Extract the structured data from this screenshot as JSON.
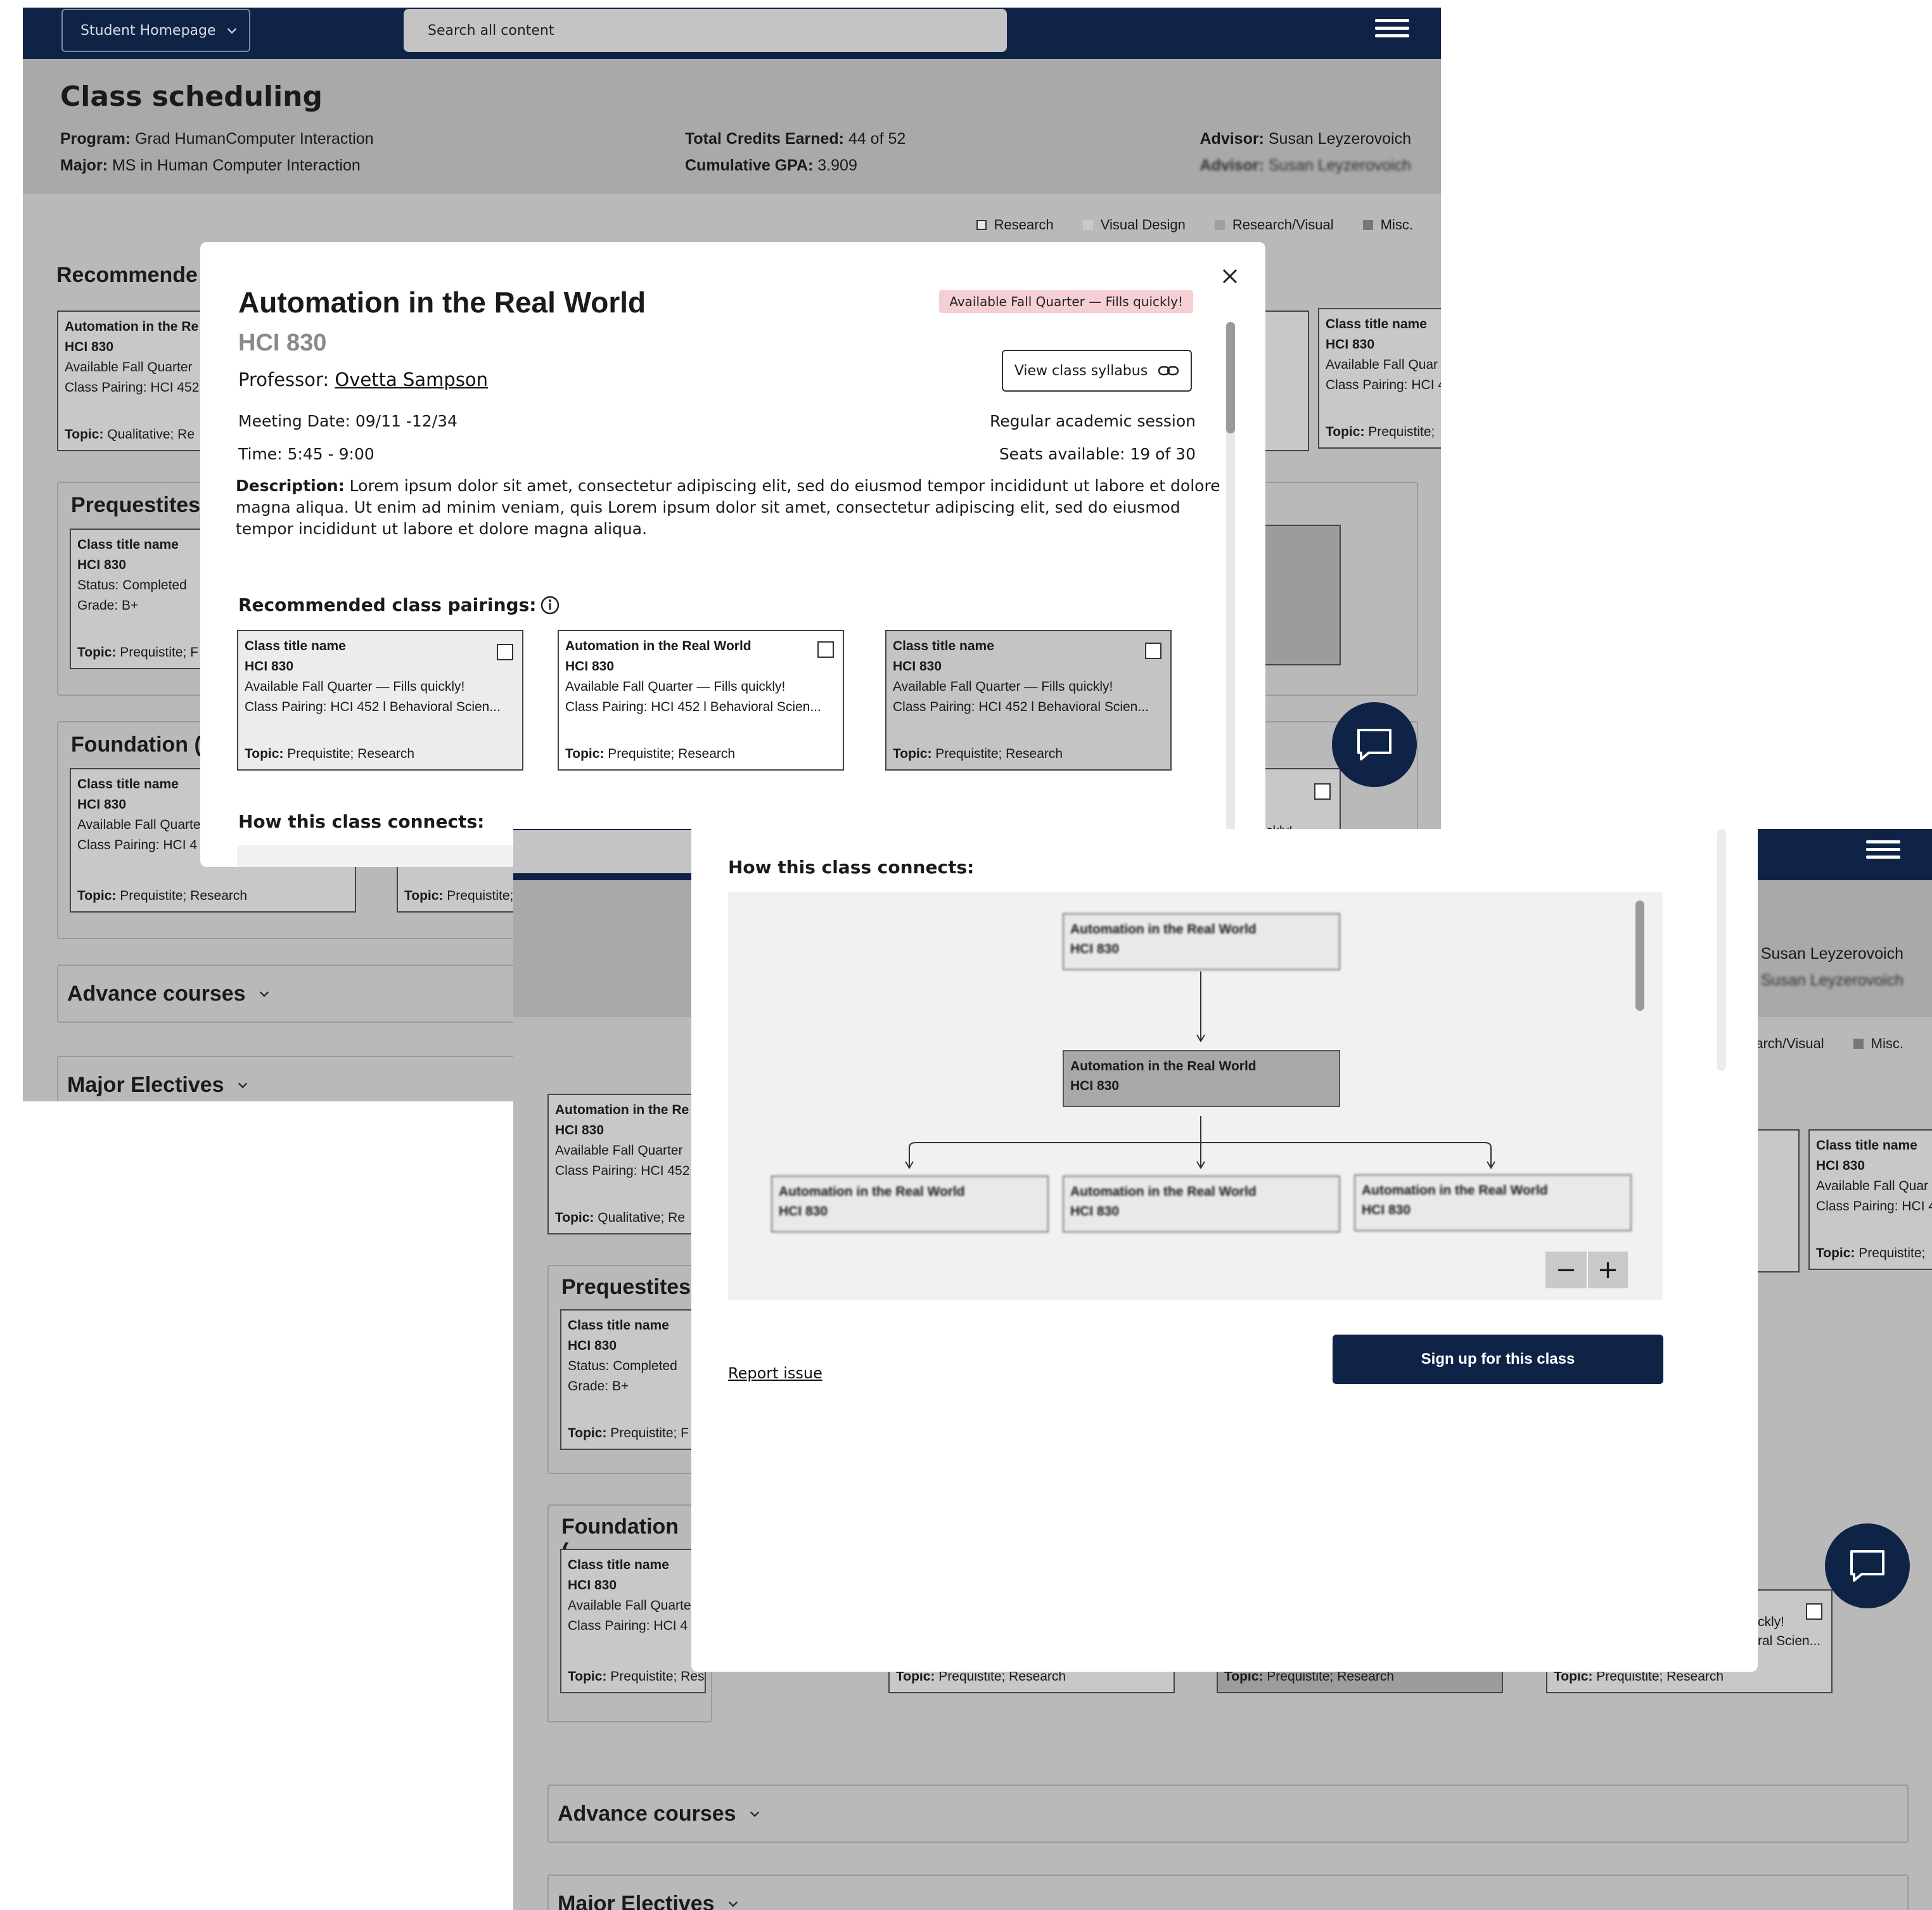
{
  "header": {
    "home_button": "Student Homepage",
    "search_placeholder": "Search all content"
  },
  "page": {
    "title": "Class scheduling",
    "program_label": "Program:",
    "program_value": "Grad HumanComputer Interaction",
    "major_label": "Major:",
    "major_value": "MS in Human Computer Interaction",
    "credits_label": "Total Credits Earned:",
    "credits_value": "44 of 52",
    "gpa_label": "Cumulative GPA:",
    "gpa_value": "3.909",
    "advisor_label": "Advisor:",
    "advisor_value": "Susan Leyzerovoich",
    "advisor_blur_label": "Advisor:",
    "advisor_blur_value": "Susan Leyzerovoich"
  },
  "legend": [
    "Research",
    "Visual Design",
    "Research/Visual",
    "Misc."
  ],
  "colors": {
    "navy": "#0f2347",
    "badge": "#f5cfd3",
    "background": "#b9b9b9"
  },
  "sections": {
    "recommended": "Recommende",
    "prereq": "Prequestites",
    "foundation": "Foundation (",
    "advance": "Advance courses",
    "electives": "Major Electives"
  },
  "bg_cards": {
    "rec_left": {
      "title": "Automation in the Re",
      "code": "HCI 830",
      "avail": "Available Fall Quarter",
      "pairing": "Class Pairing: HCI 452",
      "topic_label": "Topic:",
      "topic": "Qualitative; Re"
    },
    "rec_right": {
      "title": "Class title name",
      "code": "HCI 830",
      "avail": "Available Fall Quar",
      "pairing": "Class Pairing: HCI 4",
      "topic_label": "Topic:",
      "topic": "Prequistite;"
    },
    "prereq_left": {
      "title": "Class title name",
      "code": "HCI 830",
      "status": "Status: Completed",
      "grade": "Grade: B+",
      "topic_label": "Topic:",
      "topic": "Prequistite; F"
    },
    "found_1": {
      "title": "Class title name",
      "code": "HCI 830",
      "avail": "Available Fall Quarte",
      "pairing": "Class Pairing: HCI 4",
      "topic_label": "Topic:",
      "topic": "Prequistite; Research"
    },
    "found_topic_label": "Topic:",
    "found_topic": "Prequistite; Research",
    "found_right_avail": "ckly!",
    "found_right_pairing": "ral Scien...",
    "rec_right_ellipsis": "..."
  },
  "modal": {
    "title": "Automation in the Real World",
    "code": "HCI 830",
    "badge": "Available Fall Quarter — Fills quickly!",
    "professor_label": "Professor:",
    "professor": "Ovetta Sampson",
    "syllabus_button": "View class syllabus",
    "meeting_label": "Meeting Date:",
    "meeting_value": "09/11 -12/34",
    "time_label": "Time:",
    "time_value": "5:45 - 9:00",
    "session": "Regular academic session",
    "seats_label": "Seats available:",
    "seats_value": "19 of 30",
    "description_label": "Description:",
    "description": "Lorem ipsum dolor sit amet, consectetur adipiscing elit, sed do eiusmod tempor incididunt ut labore et dolore magna aliqua. Ut enim ad minim veniam, quis Lorem ipsum dolor sit amet, consectetur adipiscing elit, sed do eiusmod tempor incididunt ut labore et dolore magna aliqua.",
    "pairings_heading": "Recommended class pairings:",
    "pairings": [
      {
        "title": "Class title name",
        "code": "HCI 830",
        "avail": "Available Fall Quarter — Fills quickly!",
        "pairing": "Class Pairing: HCI 452 l Behavioral Scien...",
        "topic_label": "Topic:",
        "topic": "Prequistite; Research"
      },
      {
        "title": "Automation in the Real World",
        "code": "HCI 830",
        "avail": "Available Fall Quarter — Fills quickly!",
        "pairing": "Class Pairing: HCI 452 l Behavioral Scien...",
        "topic_label": "Topic:",
        "topic": "Prequistite; Research"
      },
      {
        "title": "Class title name",
        "code": "HCI 830",
        "avail": "Available Fall Quarter — Fills quickly!",
        "pairing": "Class Pairing: HCI 452 l Behavioral Scien...",
        "topic_label": "Topic:",
        "topic": "Prequistite; Research"
      }
    ],
    "connects_heading": "How this class connects:",
    "graph_nodes": {
      "top": {
        "title": "Automation in the Real World",
        "code": "HCI 830"
      },
      "center": {
        "title": "Automation in the Real World",
        "code": "HCI 830"
      },
      "left": {
        "title": "Automation in the Real World",
        "code": "HCI 830"
      },
      "middle": {
        "title": "Automation in the Real World",
        "code": "HCI 830"
      },
      "right": {
        "title": "Automation in the Real World",
        "code": "HCI 830"
      }
    },
    "report_link": "Report issue",
    "signup_button": "Sign up for this class"
  }
}
